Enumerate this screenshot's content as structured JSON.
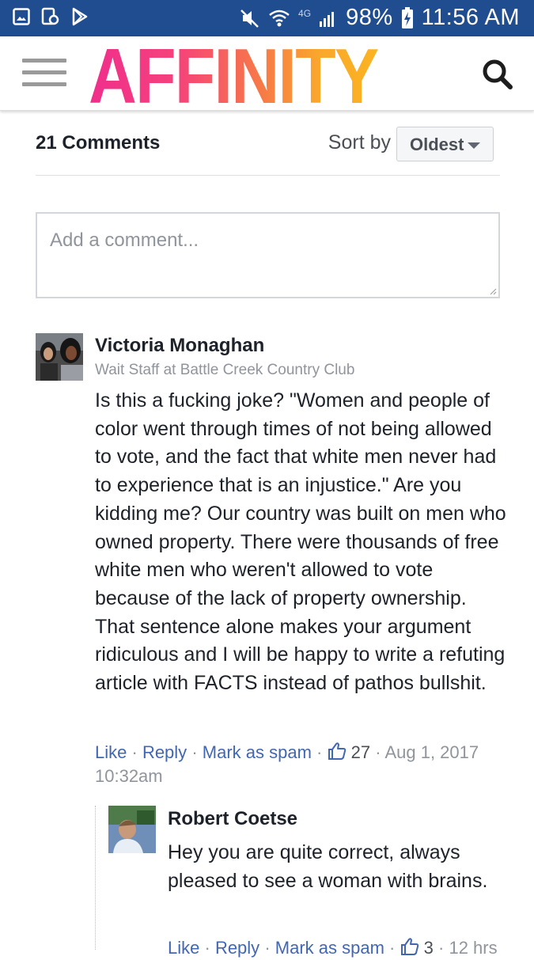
{
  "status_bar": {
    "battery": "98%",
    "time": "11:56 AM",
    "network_label": "4G",
    "left_icons": [
      "gallery-icon",
      "screenshot-icon",
      "play-store-icon"
    ],
    "right_icons": [
      "mute-icon",
      "wifi-icon",
      "signal-icon",
      "battery-charging-icon"
    ]
  },
  "header": {
    "logo": "AFFINITY",
    "menu_icon": "hamburger-icon",
    "search_icon": "search-icon",
    "colors": {
      "logo_start": "#ef2f8c",
      "logo_end": "#fbb321"
    }
  },
  "comments_section": {
    "count_label": "21 Comments",
    "sort_label": "Sort by",
    "sort_value": "Oldest",
    "input_placeholder": "Add a comment..."
  },
  "comments": [
    {
      "author": "Victoria Monaghan",
      "subtitle": "Wait Staff at Battle Creek Country Club",
      "body": "Is this a fucking joke? \"Women and people of color went through times of not being allowed to vote, and the fact that white men never had to experience that is an injustice.\" Are you kidding me? Our country was built on men who owned property. There were thousands of free white men who weren't allowed to vote because of the lack of property ownership. That sentence alone makes your argument ridiculous and I will be happy to write a refuting article with FACTS instead of pathos bullshit.",
      "like_label": "Like",
      "reply_label": "Reply",
      "spam_label": "Mark as spam",
      "likes": "27",
      "date": "Aug 1, 2017",
      "time": "10:32am"
    }
  ],
  "reply": {
    "author": "Robert Coetse",
    "body": "Hey you are quite correct, always pleased to see a woman with brains.",
    "like_label": "Like",
    "reply_label": "Reply",
    "spam_label": "Mark as spam",
    "likes": "3",
    "time": "12 hrs"
  },
  "colors": {
    "status_bar_bg": "#1f4d8f",
    "link": "#4267b2",
    "muted": "#90949c",
    "text": "#1d2129"
  }
}
